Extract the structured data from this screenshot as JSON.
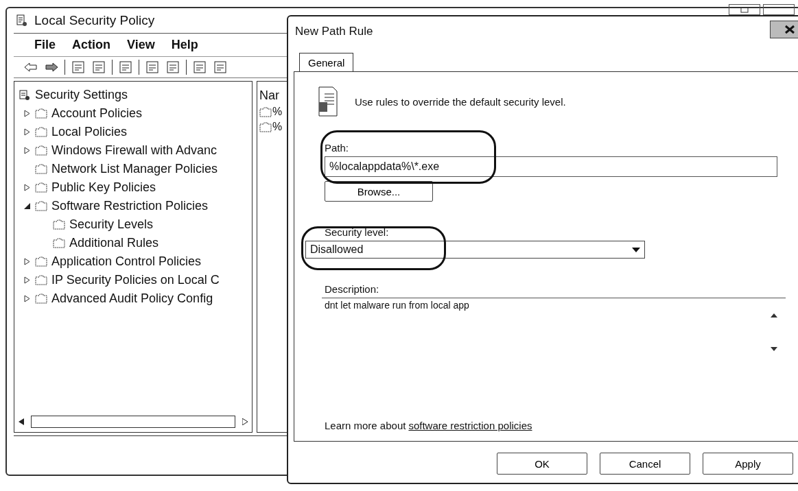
{
  "main_window": {
    "title": "Local Security Policy",
    "menu": [
      "File",
      "Action",
      "View",
      "Help"
    ],
    "tree": {
      "label": "Security Settings",
      "children": [
        {
          "label": "Account Policies",
          "expandable": true,
          "expanded": false
        },
        {
          "label": "Local Policies",
          "expandable": true,
          "expanded": false
        },
        {
          "label": "Windows Firewall with Advanc",
          "expandable": true,
          "expanded": false
        },
        {
          "label": "Network List Manager Policies",
          "expandable": false
        },
        {
          "label": "Public Key Policies",
          "expandable": true,
          "expanded": false
        },
        {
          "label": "Software Restriction Policies",
          "expandable": true,
          "expanded": true,
          "children": [
            {
              "label": "Security Levels",
              "expandable": false
            },
            {
              "label": "Additional Rules",
              "expandable": false
            }
          ]
        },
        {
          "label": "Application Control Policies",
          "expandable": true,
          "expanded": false
        },
        {
          "label": "IP Security Policies on Local C",
          "expandable": true,
          "expanded": false
        },
        {
          "label": "Advanced Audit Policy Config",
          "expandable": true,
          "expanded": false
        }
      ]
    },
    "list": {
      "column_1": "Nar",
      "rows": [
        "%",
        "%"
      ]
    }
  },
  "dialog": {
    "title": "New Path Rule",
    "tabs": [
      {
        "label": "General",
        "selected": true
      }
    ],
    "intro": "Use rules to override the default security level.",
    "path": {
      "label": "Path:",
      "value": "%localappdata%\\*.exe",
      "button": "Browse..."
    },
    "security_level": {
      "label": "Security level:",
      "value": "Disallowed"
    },
    "description": {
      "label": "Description:",
      "value": "dnt let malware run from local app"
    },
    "learn_more": {
      "text": "Learn more about",
      "link": "software restriction policies"
    },
    "buttons": [
      "OK",
      "Cancel",
      "Apply"
    ]
  }
}
